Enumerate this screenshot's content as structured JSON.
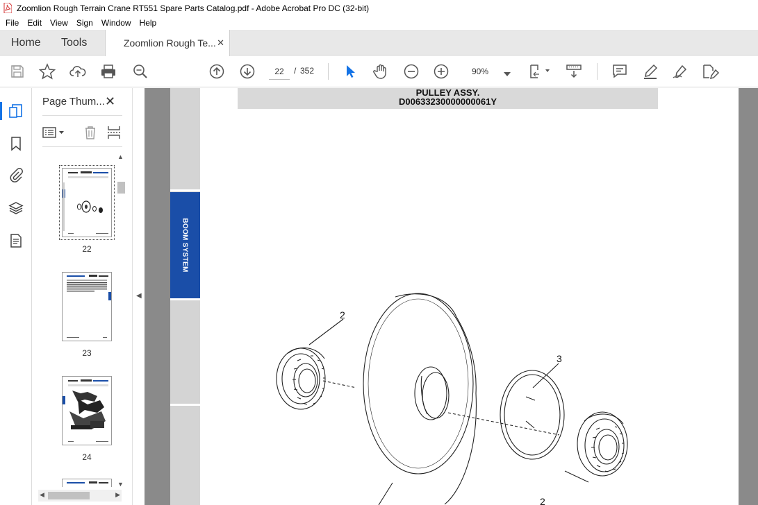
{
  "window": {
    "title": "Zoomlion Rough Terrain Crane RT551 Spare Parts Catalog.pdf - Adobe Acrobat Pro DC (32-bit)"
  },
  "menu": [
    "File",
    "Edit",
    "View",
    "Sign",
    "Window",
    "Help"
  ],
  "tabs": {
    "home": "Home",
    "tools": "Tools",
    "document": "Zoomlion Rough Te...",
    "close_glyph": "✕"
  },
  "toolbar": {
    "current_page": "22",
    "page_sep": "/",
    "total_pages": "352",
    "zoom": "90%",
    "icons": [
      "save-icon",
      "bookmark-star-icon",
      "upload-cloud-icon",
      "print-icon",
      "zoom-search-icon",
      "arrow-up-circle-icon",
      "arrow-down-circle-icon",
      "cursor-select-icon",
      "hand-pan-icon",
      "zoom-out-icon",
      "zoom-in-icon",
      "page-fit-icon",
      "scroll-mode-icon",
      "comment-icon",
      "highlight-pen-icon",
      "draw-sign-icon",
      "edit-fill-sign-icon"
    ]
  },
  "panel": {
    "title": "Page Thum...",
    "close_glyph": "✕",
    "thumbnails": [
      {
        "label": "22",
        "selected": true
      },
      {
        "label": "23",
        "selected": false
      },
      {
        "label": "24",
        "selected": false
      }
    ]
  },
  "document": {
    "header_line1": "PULLEY ASSY.",
    "header_line2": "D00633230000000061Y",
    "side_tab": "BOOM SYSTEM",
    "callouts": [
      "2",
      "3",
      "2"
    ]
  },
  "colors": {
    "accent": "#1473e6",
    "side_tab": "#1a4ea8",
    "doc_bg": "#8a8a8a"
  }
}
